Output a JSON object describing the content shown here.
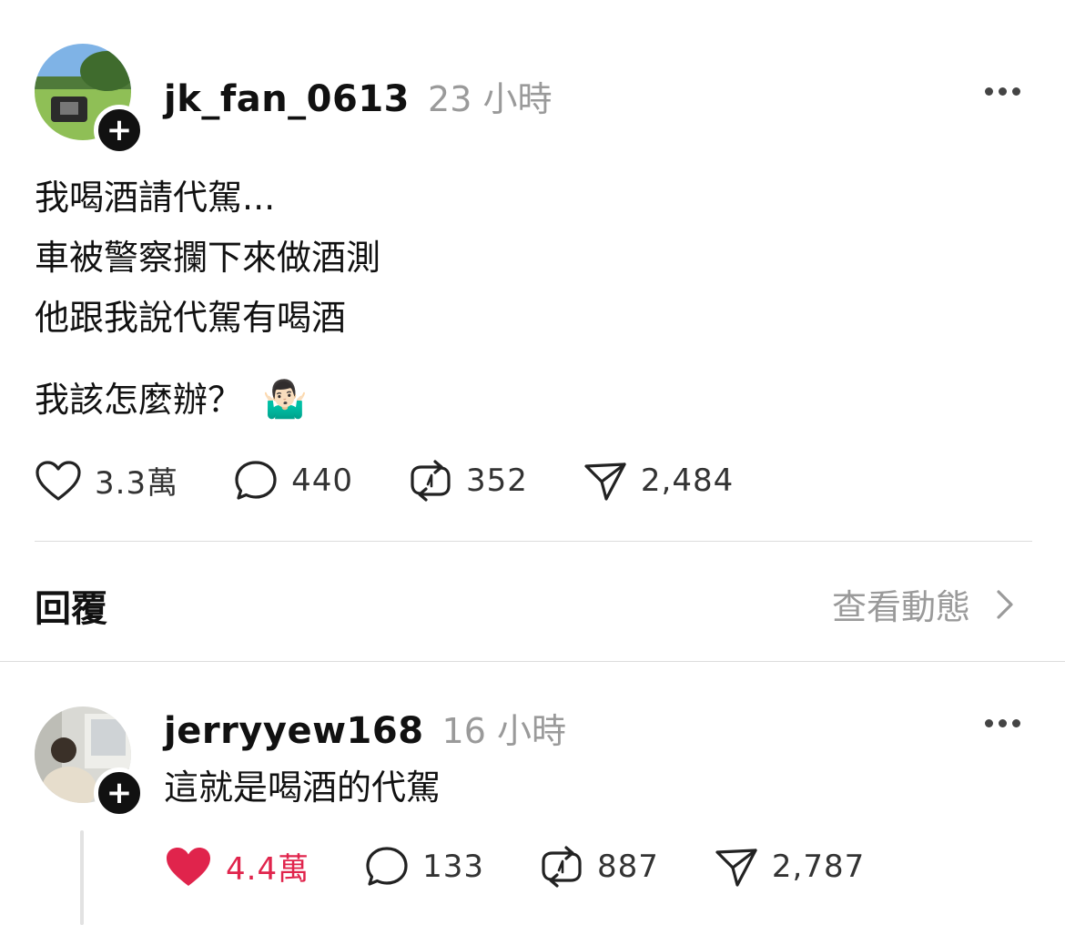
{
  "post": {
    "username": "jk_fan_0613",
    "time": "23 小時",
    "lines": [
      "我喝酒請代駕...",
      "車被警察攔下來做酒測",
      "他跟我說代駕有喝酒"
    ],
    "question": "我該怎麼辦？",
    "emoji": "🤷🏻‍♂️",
    "actions": {
      "likes": "3.3萬",
      "comments": "440",
      "reposts": "352",
      "shares": "2,484"
    }
  },
  "replies_header": {
    "title": "回覆",
    "view_activity": "查看動態"
  },
  "reply": {
    "username": "jerryyew168",
    "time": "16 小時",
    "text": "這就是喝酒的代駕",
    "actions": {
      "likes": "4.4萬",
      "comments": "133",
      "reposts": "887",
      "shares": "2,787"
    }
  },
  "colors": {
    "liked": "#e0244c",
    "muted": "#9a9a9a",
    "divider": "#dcdcdc"
  }
}
